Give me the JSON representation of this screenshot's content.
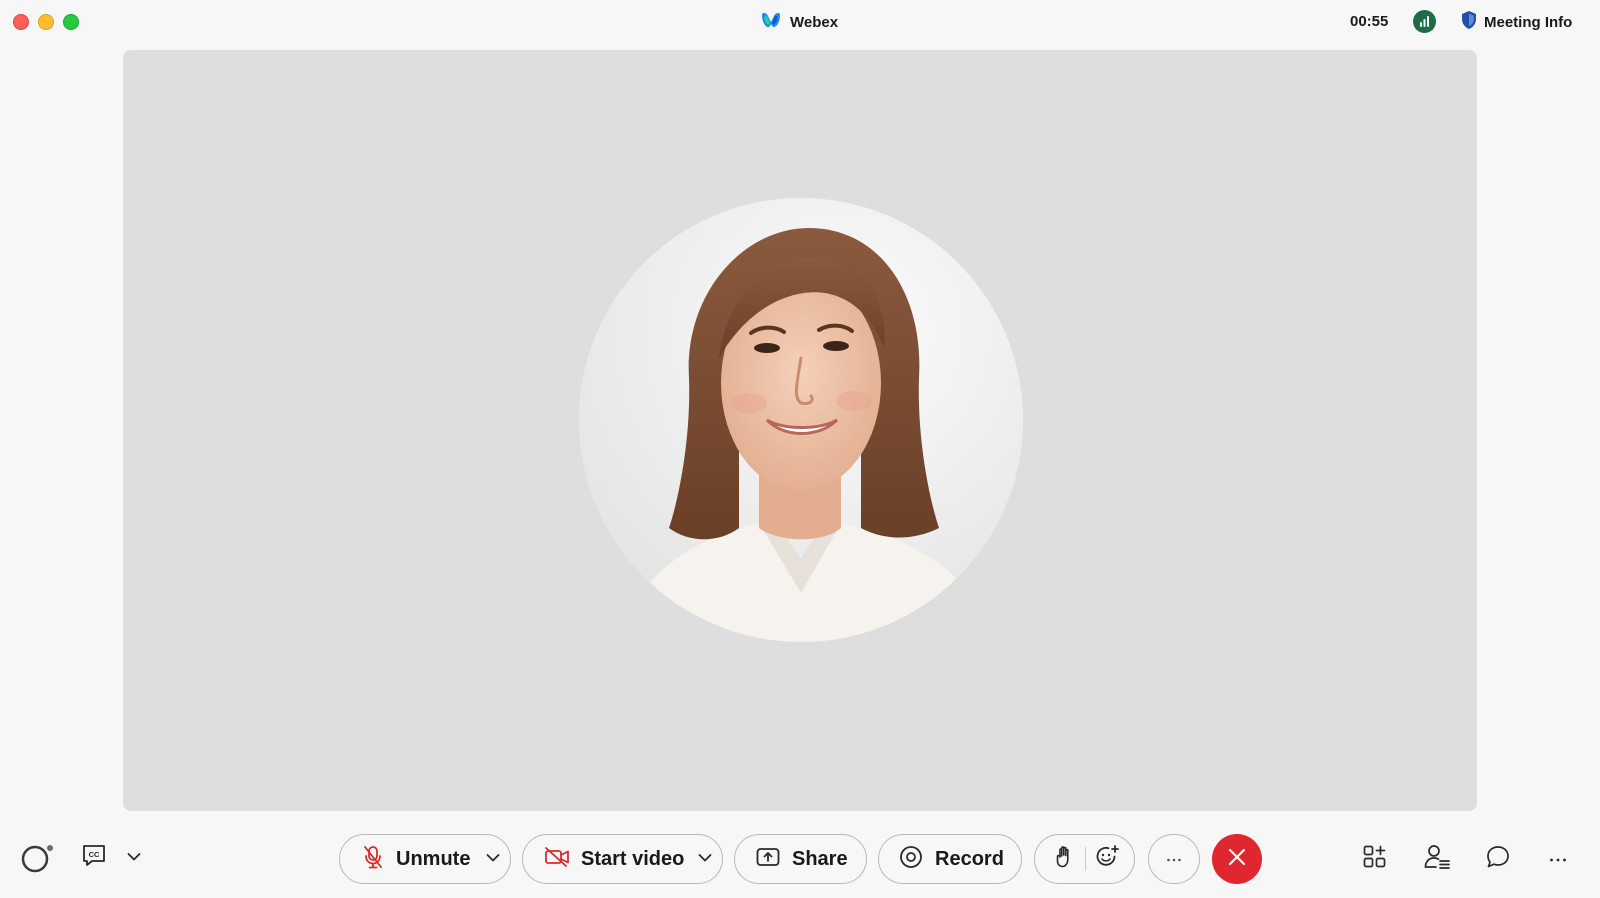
{
  "titlebar": {
    "app_name": "Webex",
    "timer": "00:55",
    "meeting_info_label": "Meeting Info"
  },
  "colors": {
    "end_call": "#e0272f",
    "muted_red": "#d92b2b",
    "signal_green": "#1f6b45",
    "shield_blue": "#1f4fa8"
  },
  "toolbar": {
    "unmute_label": "Unmute",
    "start_video_label": "Start video",
    "share_label": "Share",
    "record_label": "Record"
  },
  "icons": [
    "close-window",
    "minimize-window",
    "maximize-window",
    "webex-logo-icon",
    "signal-strength-icon",
    "shield-icon",
    "ai-assistant-icon",
    "captions-icon",
    "chevron-down-icon",
    "microphone-muted-icon",
    "camera-off-icon",
    "share-screen-icon",
    "record-icon",
    "raise-hand-icon",
    "reactions-icon",
    "more-icon",
    "end-call-icon",
    "apps-icon",
    "participants-icon",
    "chat-icon"
  ]
}
